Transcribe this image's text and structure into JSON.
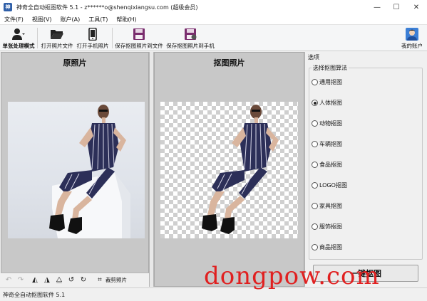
{
  "window": {
    "title": "神奇全自动抠图软件 5.1 - z******o@shenqixiangsu.com (超级会员)",
    "app_icon_glyph": "神"
  },
  "window_controls": {
    "minimize": "—",
    "maximize": "☐",
    "close": "✕"
  },
  "menu": [
    "文件(F)",
    "视图(V)",
    "账户(A)",
    "工具(T)",
    "帮助(H)"
  ],
  "toolbar": {
    "mode_label": "单张处理模式",
    "open_file": "打开照片文件",
    "open_phone": "打开手机照片",
    "save_file": "保存抠图照片到文件",
    "save_phone": "保存抠图照片到手机",
    "account": "我的账户"
  },
  "panels": {
    "original_title": "原照片",
    "cutout_title": "抠图照片"
  },
  "bottom_tools": {
    "crop_label": "裁剪照片",
    "icons": [
      "undo-icon",
      "redo-icon",
      "flip-horizontal-icon",
      "flip-vertical-icon",
      "mirror-icon",
      "rotate-left-icon",
      "rotate-right-icon",
      "crop-icon"
    ]
  },
  "options": {
    "header": "选项",
    "group_title": "选择抠图算法",
    "algorithms": [
      "通用抠图",
      "人体抠图",
      "动物抠图",
      "车辆抠图",
      "食品抠图",
      "LOGO抠图",
      "家具抠图",
      "服饰抠图",
      "商品抠图"
    ],
    "selected_index": 1,
    "action_button": "一键抠图"
  },
  "status": {
    "text": "神奇全自动抠图软件 5.1"
  },
  "watermark": "dongpow.com",
  "colors": {
    "accent": "#2f5fa8",
    "watermark": "#e02020",
    "panel_bg": "#c8c8c8"
  }
}
